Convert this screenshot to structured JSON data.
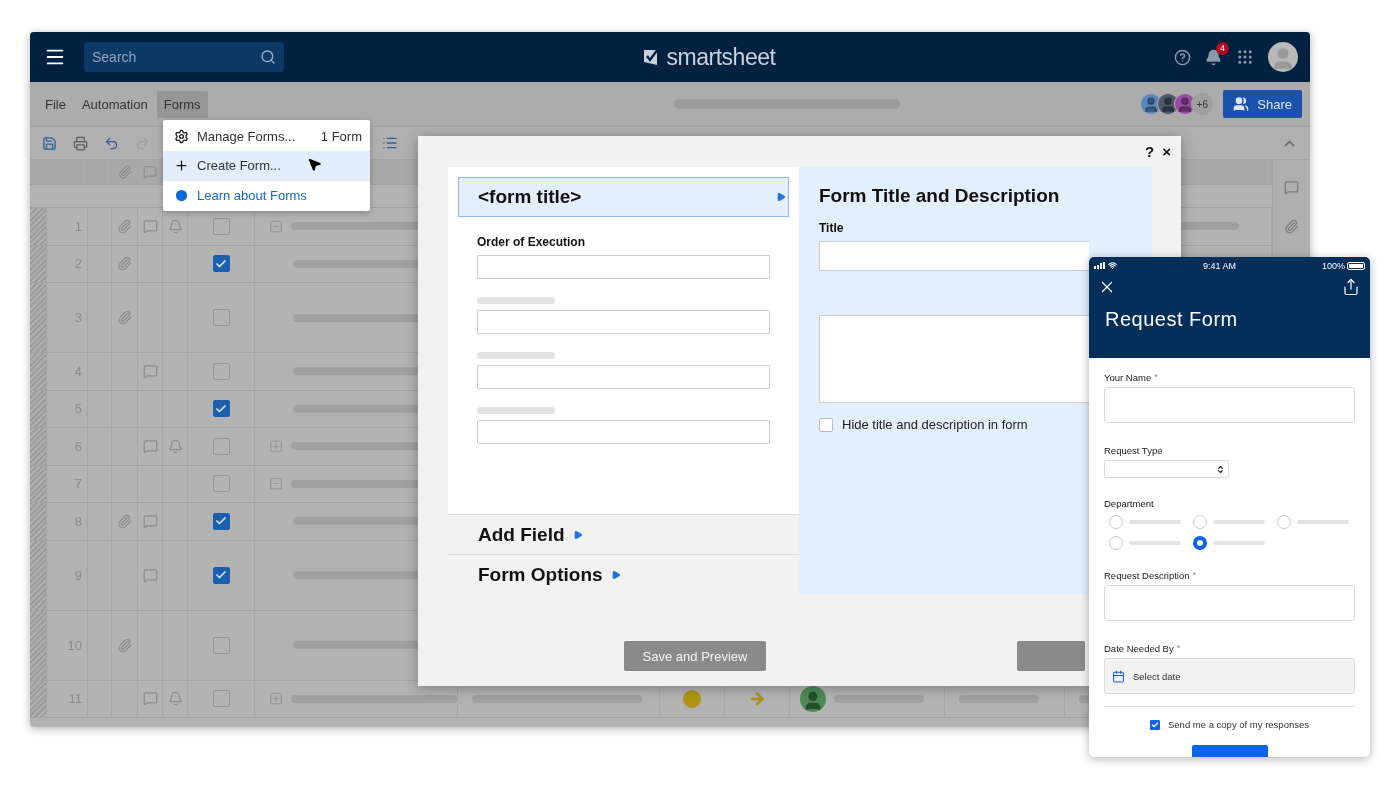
{
  "topbar": {
    "search": {
      "placeholder": "Search"
    },
    "logo": "smartsheet",
    "notifications": "4"
  },
  "menubar": {
    "menus": [
      {
        "label": "File",
        "selected": false
      },
      {
        "label": "Automation",
        "selected": false
      },
      {
        "label": "Forms",
        "selected": true
      }
    ],
    "collaborators": [
      {
        "color": "#5a87bd"
      },
      {
        "color": "#4b5866"
      },
      {
        "color": "#9a4aa4"
      }
    ],
    "more": "+6",
    "share": "Share"
  },
  "forms_menu": [
    {
      "kind": "gear",
      "label": "Manage Forms...",
      "count": "1 Form",
      "selected": false
    },
    {
      "kind": "plus",
      "label": "Create Form...",
      "selected": true
    },
    {
      "kind": "learn",
      "label": "Learn about Forms",
      "selected": false
    }
  ],
  "rows": [
    {
      "number": "1",
      "attachment": true,
      "comment": true,
      "reminder": true,
      "checked": false,
      "tall": false,
      "kind": "collapse"
    },
    {
      "number": "2",
      "attachment": true,
      "comment": false,
      "reminder": false,
      "checked": true,
      "tall": false,
      "kind": "plain"
    },
    {
      "number": "3",
      "attachment": true,
      "comment": false,
      "reminder": false,
      "checked": false,
      "tall": true,
      "kind": "plain"
    },
    {
      "number": "4",
      "attachment": false,
      "comment": true,
      "reminder": false,
      "checked": false,
      "tall": false,
      "kind": "plain"
    },
    {
      "number": "5",
      "attachment": false,
      "comment": false,
      "reminder": false,
      "checked": true,
      "tall": false,
      "kind": "plain"
    },
    {
      "number": "6",
      "attachment": false,
      "comment": true,
      "reminder": true,
      "checked": false,
      "tall": false,
      "kind": "expand"
    },
    {
      "number": "7",
      "attachment": false,
      "comment": false,
      "reminder": false,
      "checked": false,
      "tall": false,
      "kind": "collapse"
    },
    {
      "number": "8",
      "attachment": true,
      "comment": true,
      "reminder": false,
      "checked": true,
      "tall": false,
      "kind": "plain"
    },
    {
      "number": "9",
      "attachment": false,
      "comment": true,
      "reminder": false,
      "checked": true,
      "tall": true,
      "kind": "plain"
    },
    {
      "number": "10",
      "attachment": true,
      "comment": false,
      "reminder": false,
      "checked": false,
      "tall": true,
      "kind": "plain"
    },
    {
      "number": "11",
      "attachment": false,
      "comment": true,
      "reminder": true,
      "checked": false,
      "tall": false,
      "kind": "expand",
      "details": true
    }
  ],
  "dialog": {
    "help": "?",
    "close": "×",
    "title_item": {
      "label": "<form title>",
      "selected": true
    },
    "fields": [
      {
        "kind": "label",
        "label": "Order of Execution"
      },
      {
        "kind": "skeleton"
      },
      {
        "kind": "skeleton"
      },
      {
        "kind": "skeleton"
      }
    ],
    "sections": [
      "Add Field",
      "Form Options"
    ],
    "panel": {
      "heading": "Form Title and Description",
      "title_label": "Title",
      "hide": {
        "label": "Hide title and description in form",
        "checked": false
      }
    },
    "buttons": [
      {
        "kind": "text",
        "label": "Save and Preview"
      },
      {
        "kind": "blank"
      }
    ]
  },
  "mobile": {
    "time": "9:41 AM",
    "battery": "100%",
    "title": "Request Form",
    "fields": [
      {
        "kind": "text",
        "label": "Your Name",
        "mark": "*"
      },
      {
        "kind": "select",
        "label": "Request Type"
      },
      {
        "kind": "radio",
        "label": "Department",
        "options": [
          {
            "selected": false
          },
          {
            "selected": false
          },
          {
            "selected": false
          },
          {
            "selected": false
          },
          {
            "selected": true
          }
        ]
      },
      {
        "kind": "textarea",
        "label": "Request Description",
        "mark": "*"
      },
      {
        "kind": "date",
        "label": "Date Needed By",
        "mark": "*",
        "placeholder": "Select date"
      }
    ],
    "copy": {
      "label": "Send me a copy of my responses",
      "checked": true
    }
  }
}
